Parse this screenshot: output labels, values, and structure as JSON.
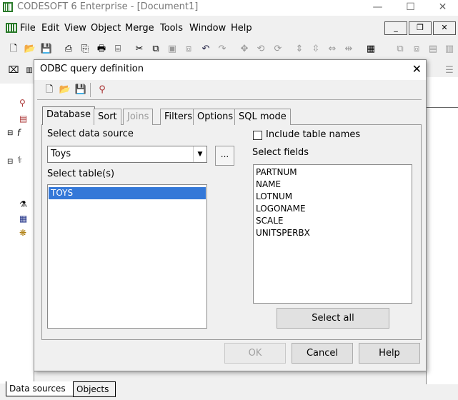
{
  "app": {
    "title": "CODESOFT 6 Enterprise - [Document1]",
    "minimize": "—",
    "maximize": "☐",
    "close": "✕"
  },
  "menu": {
    "items": [
      "File",
      "Edit",
      "View",
      "Object",
      "Merge",
      "Tools",
      "Window",
      "Help"
    ],
    "mdi_minimize": "_",
    "mdi_restore": "❐",
    "mdi_close": "✕"
  },
  "bottom_tabs": [
    "Data sources",
    "Objects"
  ],
  "dialog": {
    "title": "ODBC query definition",
    "close": "✕",
    "tabs": [
      {
        "label": "Database",
        "state": "active"
      },
      {
        "label": "Sort",
        "state": "normal"
      },
      {
        "label": "Joins",
        "state": "disabled"
      },
      {
        "label": "Filters",
        "state": "normal"
      },
      {
        "label": "Options",
        "state": "normal"
      },
      {
        "label": "SQL mode",
        "state": "normal"
      }
    ],
    "select_data_source_label": "Select data source",
    "data_source_value": "Toys",
    "browse_label": "...",
    "select_tables_label": "Select table(s)",
    "tables": [
      "TOYS"
    ],
    "selected_table": "TOYS",
    "include_table_names_label": "Include table names",
    "include_table_names_checked": false,
    "select_fields_label": "Select fields",
    "fields": [
      "PARTNUM",
      "NAME",
      "LOTNUM",
      "LOGONAME",
      "SCALE",
      "UNITSPERBX"
    ],
    "select_all_label": "Select all",
    "ok_label": "OK",
    "cancel_label": "Cancel",
    "help_label": "Help"
  },
  "colors": {
    "selection": "#3478d8",
    "dialog_bg": "#f0f0f0",
    "disabled_text": "#a0a0a0"
  }
}
